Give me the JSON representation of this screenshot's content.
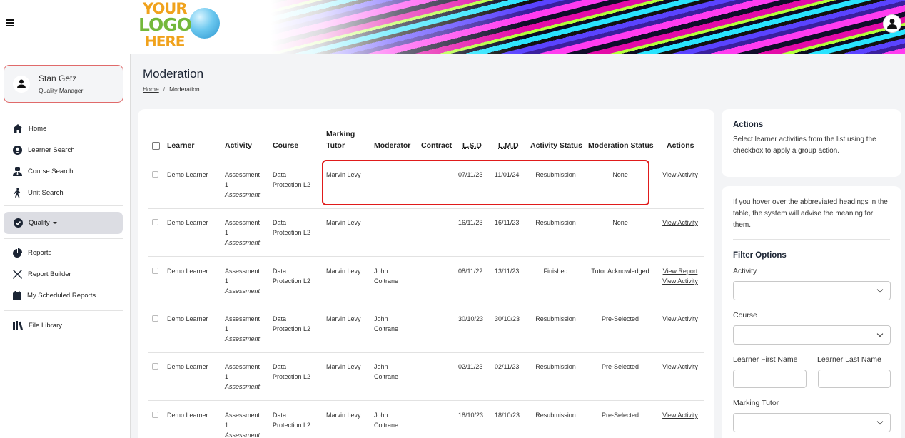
{
  "header": {
    "logo": {
      "line1": "YOUR",
      "line2": "LOGO",
      "line3": "HERE"
    }
  },
  "sidebar": {
    "user": {
      "name": "Stan Getz",
      "role": "Quality Manager"
    },
    "items": [
      {
        "label": "Home",
        "icon": "home-icon"
      },
      {
        "label": "Learner Search",
        "icon": "user-circle-icon"
      },
      {
        "label": "Course Search",
        "icon": "user-tie-icon"
      },
      {
        "label": "Unit Search",
        "icon": "walking-icon"
      },
      {
        "label": "Quality",
        "icon": "check-circle-icon"
      },
      {
        "label": "Reports",
        "icon": "pie-chart-icon"
      },
      {
        "label": "Report Builder",
        "icon": "tools-icon"
      },
      {
        "label": "My Scheduled Reports",
        "icon": "calendar-icon"
      },
      {
        "label": "File Library",
        "icon": "book-icon"
      }
    ]
  },
  "page": {
    "title": "Moderation",
    "breadcrumb": {
      "home": "Home",
      "separator": "/",
      "current": "Moderation"
    }
  },
  "table": {
    "headers": {
      "learner": "Learner",
      "activity": "Activity",
      "course": "Course",
      "marking_tutor_1": "Marking",
      "marking_tutor_2": "Tutor",
      "moderator": "Moderator",
      "contract": "Contract",
      "lsd": "L.S.D",
      "lmd": "L.M.D",
      "activity_status": "Activity Status",
      "moderation_status": "Moderation Status",
      "actions": "Actions"
    },
    "rows": [
      {
        "learner": "Demo Learner",
        "activity_1": "Assessment",
        "activity_2": "1",
        "activity_3": "Assessment",
        "course_1": "Data",
        "course_2": "Protection L2",
        "tutor": "Marvin Levy",
        "moderator_1": "",
        "moderator_2": "",
        "lsd": "07/11/23",
        "lmd": "11/01/24",
        "activity_status": "Resubmission",
        "moderation_status": "None",
        "action_1": "View Activity",
        "action_2": ""
      },
      {
        "learner": "Demo Learner",
        "activity_1": "Assessment",
        "activity_2": "1",
        "activity_3": "Assessment",
        "course_1": "Data",
        "course_2": "Protection L2",
        "tutor": "Marvin Levy",
        "moderator_1": "",
        "moderator_2": "",
        "lsd": "16/11/23",
        "lmd": "16/11/23",
        "activity_status": "Resubmission",
        "moderation_status": "None",
        "action_1": "View Activity",
        "action_2": ""
      },
      {
        "learner": "Demo Learner",
        "activity_1": "Assessment",
        "activity_2": "1",
        "activity_3": "Assessment",
        "course_1": "Data",
        "course_2": "Protection L2",
        "tutor": "Marvin Levy",
        "moderator_1": "John",
        "moderator_2": "Coltrane",
        "lsd": "08/11/22",
        "lmd": "13/11/23",
        "activity_status": "Finished",
        "moderation_status": "Tutor Acknowledged",
        "action_1": "View Report",
        "action_2": "View Activity"
      },
      {
        "learner": "Demo Learner",
        "activity_1": "Assessment",
        "activity_2": "1",
        "activity_3": "Assessment",
        "course_1": "Data",
        "course_2": "Protection L2",
        "tutor": "Marvin Levy",
        "moderator_1": "John",
        "moderator_2": "Coltrane",
        "lsd": "30/10/23",
        "lmd": "30/10/23",
        "activity_status": "Resubmission",
        "moderation_status": "Pre-Selected",
        "action_1": "View Activity",
        "action_2": ""
      },
      {
        "learner": "Demo Learner",
        "activity_1": "Assessment",
        "activity_2": "1",
        "activity_3": "Assessment",
        "course_1": "Data",
        "course_2": "Protection L2",
        "tutor": "Marvin Levy",
        "moderator_1": "John",
        "moderator_2": "Coltrane",
        "lsd": "02/11/23",
        "lmd": "02/11/23",
        "activity_status": "Resubmission",
        "moderation_status": "Pre-Selected",
        "action_1": "View Activity",
        "action_2": ""
      },
      {
        "learner": "Demo Learner",
        "activity_1": "Assessment",
        "activity_2": "1",
        "activity_3": "Assessment",
        "course_1": "Data",
        "course_2": "Protection L2",
        "tutor": "Marvin Levy",
        "moderator_1": "John",
        "moderator_2": "Coltrane",
        "lsd": "18/10/23",
        "lmd": "18/10/23",
        "activity_status": "Resubmission",
        "moderation_status": "Pre-Selected",
        "action_1": "View Activity",
        "action_2": ""
      }
    ]
  },
  "actions_panel": {
    "title": "Actions",
    "text": "Select learner activities from the list using the checkbox to apply a group action."
  },
  "filter_panel": {
    "hint": "If you hover over the abbreviated headings in the table, the system will advise the meaning for them.",
    "title": "Filter Options",
    "activity_label": "Activity",
    "course_label": "Course",
    "first_name_label": "Learner First Name",
    "last_name_label": "Learner Last Name",
    "marking_tutor_label": "Marking Tutor"
  },
  "colors": {
    "highlight": "#e01b1b",
    "accent_border": "#e06a6a"
  }
}
